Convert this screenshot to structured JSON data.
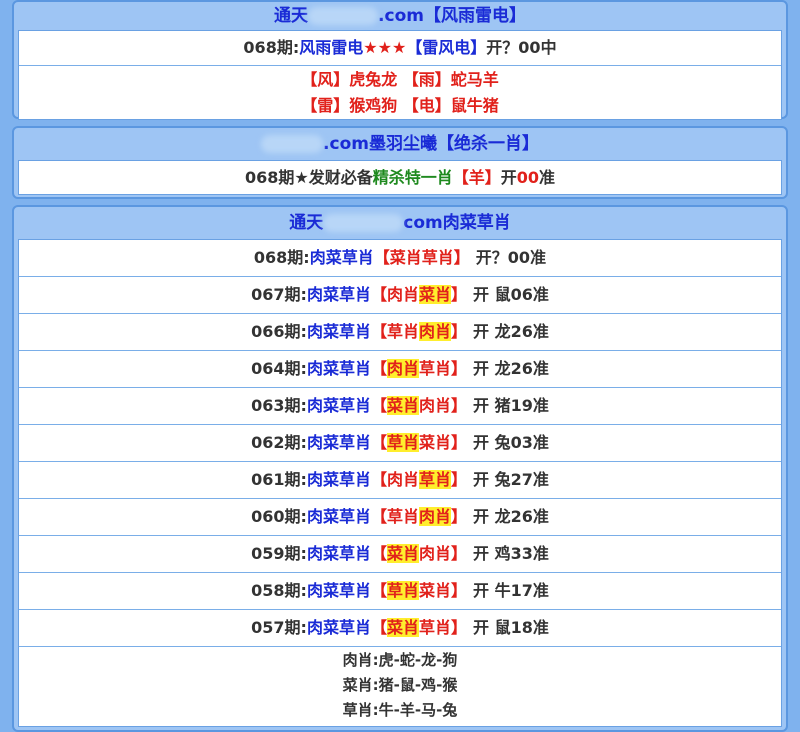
{
  "panel1": {
    "title_prefix": "通天",
    "title_suffix": ".com【风雨雷电】",
    "row": {
      "period": "068期:",
      "name": "风雨雷电",
      "stars": "★★★",
      "bracket": "【雷风电】",
      "result": "开？00中"
    },
    "groups": [
      "【风】虎兔龙 【雨】蛇马羊",
      "【雷】猴鸡狗 【电】鼠牛猪"
    ]
  },
  "panel2": {
    "title": ".com墨羽尘曦【绝杀一肖】",
    "row": {
      "prefix": "068期★发财必备",
      "green": "精杀特一肖",
      "bracket": "【羊】",
      "open": "开",
      "num": "00",
      "zhun": "准"
    }
  },
  "panel3": {
    "title_prefix": "通天",
    "title_suffix": "com肉菜草肖",
    "rows": [
      {
        "period": "068期:",
        "name": "肉菜草肖",
        "lb": "【",
        "a": "菜肖",
        "b": "草肖",
        "hl": "",
        "rb": "】",
        "result": "开？00准"
      },
      {
        "period": "067期:",
        "name": "肉菜草肖",
        "lb": "【",
        "a": "肉肖",
        "b": "菜肖",
        "hl": "b",
        "rb": "】",
        "result": "开 鼠06准"
      },
      {
        "period": "066期:",
        "name": "肉菜草肖",
        "lb": "【",
        "a": "草肖",
        "b": "肉肖",
        "hl": "b",
        "rb": "】",
        "result": "开 龙26准"
      },
      {
        "period": "064期:",
        "name": "肉菜草肖",
        "lb": "【",
        "a": "肉肖",
        "b": "草肖",
        "hl": "a",
        "rb": "】",
        "result": "开 龙26准"
      },
      {
        "period": "063期:",
        "name": "肉菜草肖",
        "lb": "【",
        "a": "菜肖",
        "b": "肉肖",
        "hl": "a",
        "rb": "】",
        "result": "开 猪19准"
      },
      {
        "period": "062期:",
        "name": "肉菜草肖",
        "lb": "【",
        "a": "草肖",
        "b": "菜肖",
        "hl": "a",
        "rb": "】",
        "result": "开 兔03准"
      },
      {
        "period": "061期:",
        "name": "肉菜草肖",
        "lb": "【",
        "a": "肉肖",
        "b": "草肖",
        "hl": "b",
        "rb": "】",
        "result": "开 兔27准"
      },
      {
        "period": "060期:",
        "name": "肉菜草肖",
        "lb": "【",
        "a": "草肖",
        "b": "肉肖",
        "hl": "b",
        "rb": "】",
        "result": "开 龙26准"
      },
      {
        "period": "059期:",
        "name": "肉菜草肖",
        "lb": "【",
        "a": "菜肖",
        "b": "肉肖",
        "hl": "a",
        "rb": "】",
        "result": "开 鸡33准"
      },
      {
        "period": "058期:",
        "name": "肉菜草肖",
        "lb": "【",
        "a": "草肖",
        "b": "菜肖",
        "hl": "a",
        "rb": "】",
        "result": "开 牛17准"
      },
      {
        "period": "057期:",
        "name": "肉菜草肖",
        "lb": "【",
        "a": "菜肖",
        "b": "草肖",
        "hl": "a",
        "rb": "】",
        "result": "开 鼠18准"
      }
    ],
    "summary": [
      "肉肖:虎-蛇-龙-狗",
      "菜肖:猪-鼠-鸡-猴",
      "草肖:牛-羊-马-兔"
    ]
  }
}
